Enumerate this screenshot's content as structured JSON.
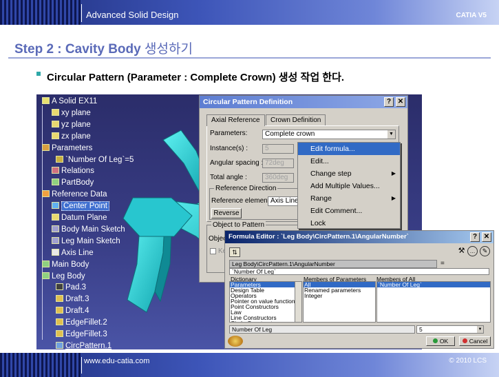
{
  "header": {
    "title": "Advanced Solid Design",
    "product": "CATIA V5"
  },
  "slide": {
    "step_title": "Step 2 : Cavity Body ",
    "step_title_ko": "생성하기",
    "bullet": "Circular Pattern (Parameter : Complete Crown) 생성 작업 한다."
  },
  "tree": [
    {
      "label": "A Solid EX11",
      "icon": "product-icon"
    },
    {
      "label": "xy plane",
      "icon": "plane-icon"
    },
    {
      "label": "yz plane",
      "icon": "plane-icon"
    },
    {
      "label": "zx plane",
      "icon": "plane-icon"
    },
    {
      "label": "Parameters",
      "icon": "parameters-icon"
    },
    {
      "label": "`Number Of Leg`=5",
      "icon": "parameter-icon"
    },
    {
      "label": "Relations",
      "icon": "relations-icon"
    },
    {
      "label": "PartBody",
      "icon": "body-icon"
    },
    {
      "label": "Reference Data",
      "icon": "geometrical-set-icon"
    },
    {
      "label": "Center Point",
      "icon": "point-icon"
    },
    {
      "label": "Datum Plane",
      "icon": "plane-icon"
    },
    {
      "label": "Body Main Sketch",
      "icon": "sketch-icon"
    },
    {
      "label": "Leg Main Sketch",
      "icon": "sketch-icon"
    },
    {
      "label": "Axis Line",
      "icon": "line-icon"
    },
    {
      "label": "Main Body",
      "icon": "body-icon"
    },
    {
      "label": "Leg Body",
      "icon": "body-icon"
    },
    {
      "label": "Pad.3",
      "icon": "pad-icon"
    },
    {
      "label": "Draft.3",
      "icon": "draft-icon"
    },
    {
      "label": "Draft.4",
      "icon": "draft-icon"
    },
    {
      "label": "EdgeFillet.2",
      "icon": "fillet-icon"
    },
    {
      "label": "EdgeFillet.3",
      "icon": "fillet-icon"
    },
    {
      "label": "CircPattern.1",
      "icon": "circpattern-icon"
    }
  ],
  "cpd": {
    "title": "Circular Pattern Definition",
    "tabs": [
      "Axial Reference",
      "Crown Definition"
    ],
    "parameters_label": "Parameters:",
    "parameters_value": "Complete crown",
    "instances_label": "Instance(s) :",
    "instances_value": "5",
    "angular_label": "Angular spacing :",
    "angular_value": "72deg",
    "total_label": "Total angle :",
    "total_value": "360deg",
    "refdir_label": "Reference Direction",
    "refelem_label": "Reference element:",
    "refelem_value": "Axis Line",
    "reverse": "Reverse",
    "object_label": "Object to Pattern",
    "object_field_label": "Objec",
    "keep_label": "Ke"
  },
  "menu": [
    {
      "label": "Edit formula...",
      "highlight": true,
      "sub": false
    },
    {
      "label": "Edit...",
      "highlight": false,
      "sub": false
    },
    {
      "label": "Change step",
      "highlight": false,
      "sub": true
    },
    {
      "label": "Add Multiple Values...",
      "highlight": false,
      "sub": false
    },
    {
      "label": "Range",
      "highlight": false,
      "sub": true
    },
    {
      "label": "Edit Comment...",
      "highlight": false,
      "sub": false
    },
    {
      "label": "Lock",
      "highlight": false,
      "sub": false
    }
  ],
  "fe": {
    "title": "Formula Editor : `Leg Body\\CircPattern.1\\AngularNumber`",
    "path": "Leg Body\\CircPattern.1\\AngularNumber",
    "eq": "=",
    "formula": "`Number Of Leg`",
    "col1": "Dictionary",
    "col2": "Members of Parameters",
    "col3": "Members of All",
    "dictionary": [
      "Parameters",
      "Design Table",
      "Operators",
      "Pointer on value functions",
      "Point Constructors",
      "Law",
      "Line Constructors",
      "Circle Constructors"
    ],
    "members_params": [
      "All",
      "Renamed parameters",
      "Integer"
    ],
    "members_all": [
      "`Number Of Leg`"
    ],
    "bottom_field": "Number Of Leg",
    "bottom_value": "5",
    "ok": "OK",
    "cancel": "Cancel"
  },
  "footer": {
    "url": "www.edu-catia.com",
    "copyright": "© 2010 LCS"
  },
  "colors": {
    "accent": "#5a6ab8",
    "model": "#2bd4d4",
    "highlight": "#316ac5"
  }
}
